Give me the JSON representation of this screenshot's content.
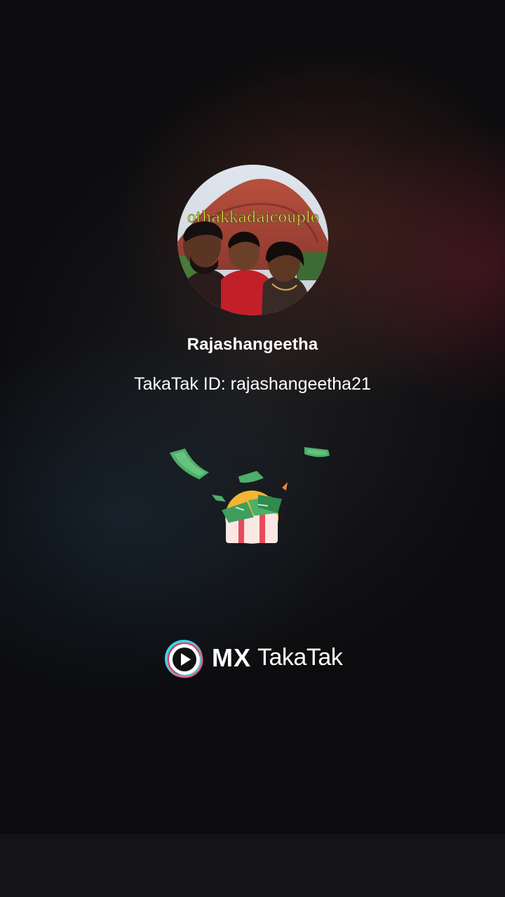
{
  "profile": {
    "avatar_caption": "othakkadaicouple",
    "display_name": "Rajashangeetha",
    "takatak_id": "TakaTak ID: rajashangeetha21"
  },
  "reward": {
    "icon": "money-gift-icon"
  },
  "brand": {
    "icon": "mx-takatak-play-icon",
    "mx": "MX",
    "takatak": "TakaTak"
  },
  "colors": {
    "background": "#0c0c0e",
    "text": "#ffffff",
    "money_green": "#4caf6a",
    "brand_cyan": "#3ad8e8",
    "brand_pink": "#ff4d7a"
  }
}
